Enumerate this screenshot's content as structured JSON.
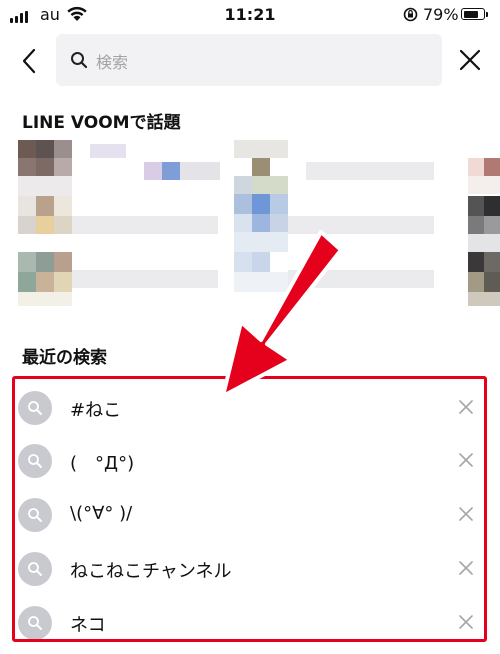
{
  "status_bar": {
    "carrier": "au",
    "time": "11:21",
    "battery_percent": "79%",
    "battery_level": 0.79
  },
  "search": {
    "placeholder": "検索"
  },
  "voom_section": {
    "title": "LINE VOOMで話題"
  },
  "recent_section": {
    "title": "最近の検索",
    "items": [
      {
        "label": "#ねこ"
      },
      {
        "label": "(　°Д°)"
      },
      {
        "label": "\\(°∀° )/"
      },
      {
        "label": "ねこねこチャンネル"
      },
      {
        "label": "ネコ"
      }
    ]
  },
  "colors": {
    "highlight": "#e5001c",
    "search_bg": "#f2f2f4",
    "circle": "#c9c9d0"
  }
}
